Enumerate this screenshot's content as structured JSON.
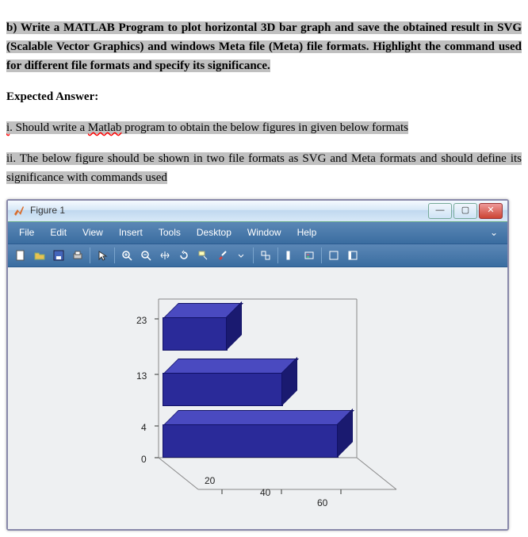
{
  "question": {
    "label": "b)",
    "text": "Write a MATLAB Program to plot horizontal 3D bar graph and save the obtained result in SVG (Scalable Vector Graphics) and windows Meta file (Meta) file formats. Highlight the command used for different file formats and specify its significance."
  },
  "expected_heading": "Expected Answer:",
  "answers": {
    "i_label": "i",
    "i_text": ". Should write a ",
    "i_word": "Matlab",
    "i_tail": " program to obtain the below figures in given below formats",
    "ii": "ii. The below figure should be shown in two file formats as SVG and Meta formats and should define its significance with commands used"
  },
  "window": {
    "title": "Figure 1",
    "menus": [
      "File",
      "Edit",
      "View",
      "Insert",
      "Tools",
      "Desktop",
      "Window",
      "Help"
    ],
    "dropglyph": "⌄"
  },
  "toolbar_icons": [
    "new-file-icon",
    "open-icon",
    "save-icon",
    "print-icon",
    "pointer-icon",
    "zoom-in-icon",
    "zoom-out-icon",
    "pan-icon",
    "rotate-icon",
    "data-cursor-icon",
    "brush-icon",
    "colorbar-icon",
    "link-icon",
    "insert-legend-icon",
    "hide-plot-tools-icon",
    "show-plot-tools-icon"
  ],
  "chart_data": {
    "type": "bar",
    "orientation": "horizontal-3d",
    "categories": [
      4,
      13,
      23
    ],
    "values": [
      60,
      40,
      20
    ],
    "y_ticks": [
      0,
      4,
      13,
      23
    ],
    "x_ticks": [
      20,
      40,
      60
    ],
    "xlabel": "",
    "ylabel": "",
    "xlim": [
      0,
      70
    ],
    "ylim": [
      0,
      25
    ]
  }
}
